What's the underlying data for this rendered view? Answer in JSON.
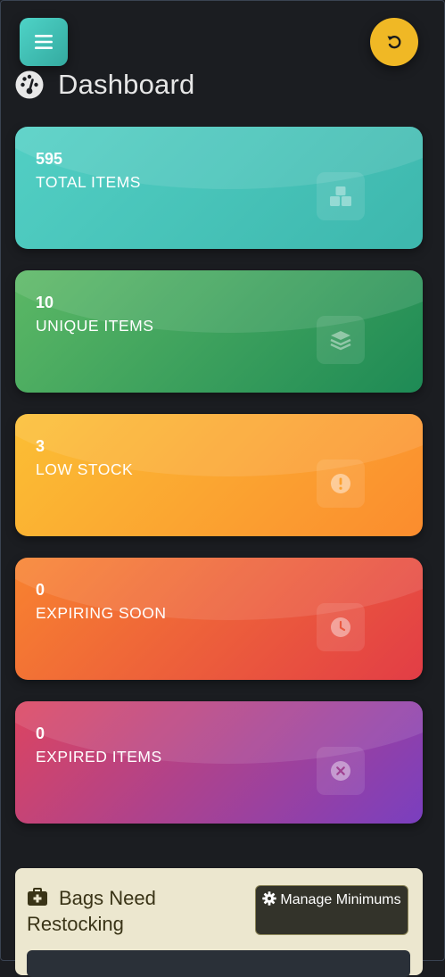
{
  "header": {
    "menu_icon": "hamburger-icon",
    "refresh_icon": "undo-icon",
    "title": "Dashboard",
    "title_icon": "speedometer-icon"
  },
  "stats": [
    {
      "value": "595",
      "label": "TOTAL ITEMS",
      "icon": "boxes-icon",
      "colors": [
        "#52cfc4",
        "#3db7ad"
      ]
    },
    {
      "value": "10",
      "label": "UNIQUE ITEMS",
      "icon": "layers-icon",
      "colors": [
        "#5cb865",
        "#1e8a55"
      ]
    },
    {
      "value": "3",
      "label": "LOW STOCK",
      "icon": "exclamation-circle-icon",
      "colors": [
        "#fbbf34",
        "#fb8c2e"
      ]
    },
    {
      "value": "0",
      "label": "EXPIRING SOON",
      "icon": "clock-icon",
      "colors": [
        "#f8832f",
        "#e23d46"
      ]
    },
    {
      "value": "0",
      "label": "EXPIRED ITEMS",
      "icon": "x-circle-icon",
      "colors": [
        "#dc4560",
        "#7a3fbf"
      ]
    }
  ],
  "restock": {
    "title": "Bags Need Restocking",
    "icon": "medkit-icon",
    "manage_button": {
      "icon": "gear-icon",
      "label": "Manage Minimums"
    }
  }
}
